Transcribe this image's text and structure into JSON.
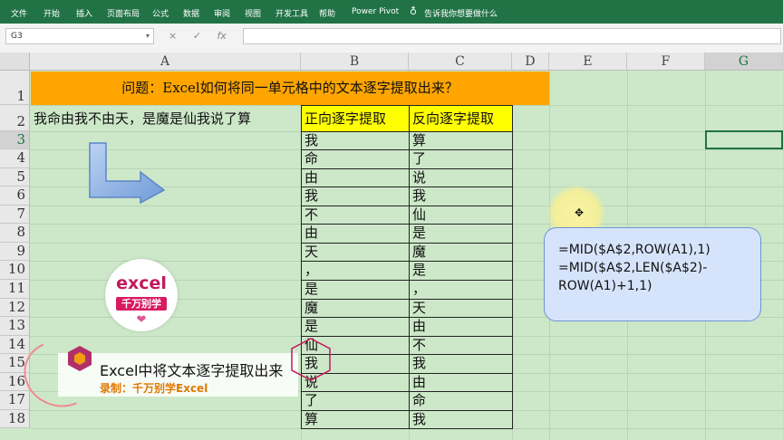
{
  "ribbon": {
    "tabs": [
      "文件",
      "开始",
      "插入",
      "页面布局",
      "公式",
      "数据",
      "审阅",
      "视图",
      "开发工具",
      "帮助",
      "Power Pivot"
    ],
    "tell_me": "告诉我你想要做什么"
  },
  "formula_bar": {
    "name_box": "G3",
    "cancel_icon": "×",
    "enter_icon": "✓",
    "fx_label": "fx",
    "content": ""
  },
  "columns": [
    "A",
    "B",
    "C",
    "D",
    "E",
    "F",
    "G"
  ],
  "rows": [
    "1",
    "2",
    "3",
    "4",
    "5",
    "6",
    "7",
    "8",
    "9",
    "10",
    "11",
    "12",
    "13",
    "14",
    "15",
    "16",
    "17",
    "18"
  ],
  "sheet": {
    "title": "问题：Excel如何将同一单元格中的文本逐字提取出来？",
    "a2": "我命由我不由天，是魔是仙我说了算",
    "header_b": "正向逐字提取",
    "header_c": "反向逐字提取",
    "col_b": [
      "我",
      "命",
      "由",
      "我",
      "不",
      "由",
      "天",
      "，",
      "是",
      "魔",
      "是",
      "仙",
      "我",
      "说",
      "了",
      "算"
    ],
    "col_c": [
      "算",
      "了",
      "说",
      "我",
      "仙",
      "是",
      "魔",
      "是",
      "，",
      "天",
      "由",
      "不",
      "我",
      "由",
      "命",
      "我"
    ]
  },
  "formula_note": {
    "line1": "=MID($A$2,ROW(A1),1)",
    "line2": "=MID($A$2,LEN($A$2)-",
    "line3": "ROW(A1)+1,1)"
  },
  "logo": {
    "word": "excel",
    "tag": "千万别学",
    "heart": "❤"
  },
  "banner": {
    "title": "Excel中将文本逐字提取出来",
    "subtitle": "录制：千万别学Excel"
  },
  "colors": {
    "ribbon": "#217346",
    "title_fill": "#ffa500",
    "header_fill": "#ffff00",
    "sheet_bg": "#cde8c9"
  }
}
